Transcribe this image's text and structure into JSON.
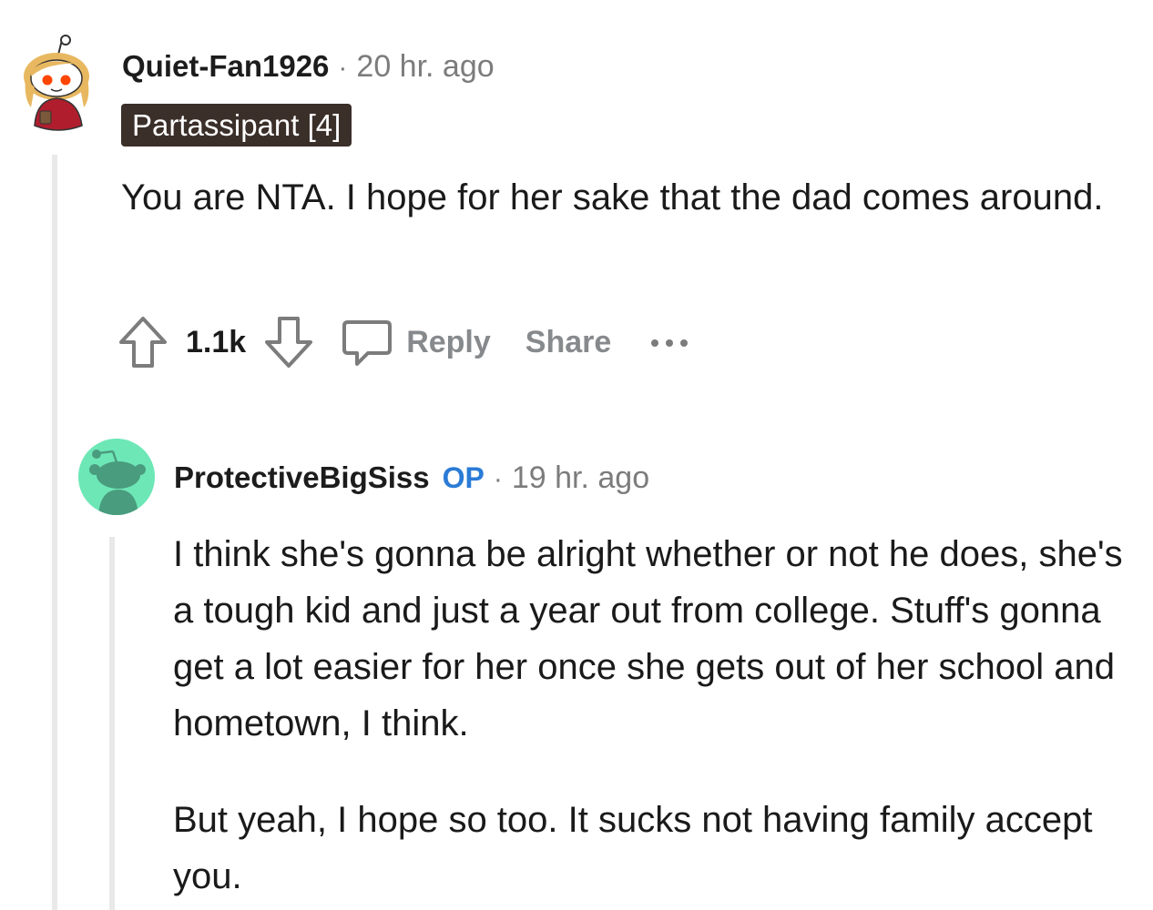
{
  "comment1": {
    "username": "Quiet-Fan1926",
    "separator": "·",
    "time": "20 hr. ago",
    "flair": "Partassipant [4]",
    "body": "You are NTA. I hope for her sake that the dad comes around.",
    "score": "1.1k",
    "reply_label": "Reply",
    "share_label": "Share",
    "more_label": "•••"
  },
  "comment2": {
    "username": "ProtectiveBigSiss",
    "op_badge": "OP",
    "separator": "·",
    "time": "19 hr. ago",
    "body_p1": "I think she's gonna be alright whether or not he does, she's a tough kid and just a year out from college. Stuff's gonna get a lot easier for her once she gets out of her school and hometown, I think.",
    "body_p2": "But yeah, I hope so too. It sucks not having family accept you."
  },
  "colors": {
    "op_accent": "#2a7bd6",
    "flair_bg": "#3b2f2a",
    "muted_text": "#7c7c7c",
    "action_gray": "#878a8c",
    "avatar2_bg": "#6ee7b7",
    "thread_line": "#e9e9ea"
  },
  "icons": {
    "upvote": "upvote-arrow-icon",
    "downvote": "downvote-arrow-icon",
    "reply": "speech-bubble-icon",
    "more": "ellipsis-icon"
  }
}
